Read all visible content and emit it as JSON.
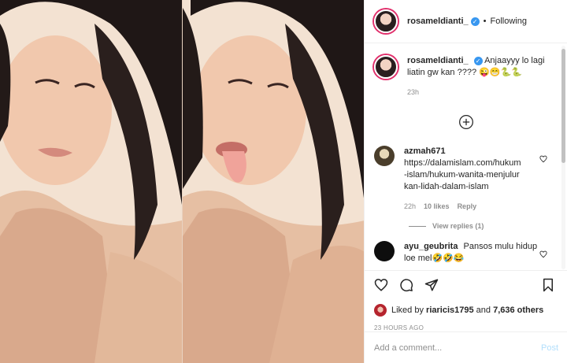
{
  "header": {
    "username": "rosameldianti_",
    "verified_glyph": "✓",
    "separator": "•",
    "follow_status": "Following"
  },
  "caption": {
    "username": "rosameldianti_",
    "text": "Anjaayyy lo lagi liatin gw kan ???? 😜😁🐍🐍",
    "age": "23h"
  },
  "comments": [
    {
      "username": "azmah671",
      "text": "https://dalamislam.com/hukum-islam/hukum-wanita-menjulurkan-lidah-dalam-islam",
      "age": "22h",
      "likes": "10 likes",
      "reply": "Reply",
      "view_replies": "View replies (1)"
    },
    {
      "username": "ayu_geubrita",
      "text": "Pansos mulu hidup loe mel🤣🤣😂"
    }
  ],
  "likes": {
    "prefix": "Liked by",
    "user": "riaricis1795",
    "conjunction": "and",
    "others": "7,636 others"
  },
  "timestamp": "23 HOURS AGO",
  "composer": {
    "placeholder": "Add a comment...",
    "post_label": "Post"
  },
  "colors": {
    "accent_blue": "#3897f0",
    "post_disabled": "#b2dffc",
    "muted_text": "#8e8e8e",
    "story_ring": "#e1306c"
  },
  "icons": [
    "heart-icon",
    "comment-icon",
    "share-icon",
    "bookmark-icon",
    "add-circle-icon",
    "verified-badge-icon"
  ]
}
